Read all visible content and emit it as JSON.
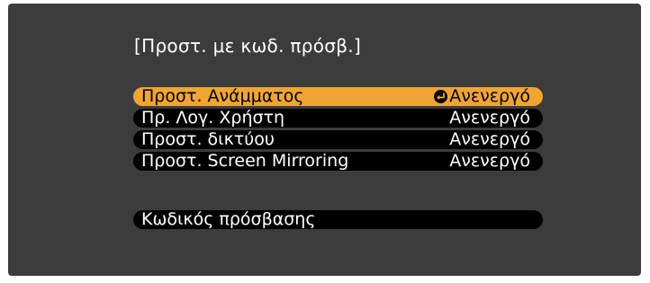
{
  "title": "[Προστ. με κωδ. πρόσβ.]",
  "menu": {
    "items": [
      {
        "label": "Προστ. Ανάμματος",
        "value": "Ανενεργό",
        "selected": true
      },
      {
        "label": "Πρ. Λογ. Χρήστη",
        "value": "Ανενεργό"
      },
      {
        "label": "Προστ. δικτύου",
        "value": "Ανενεργό"
      },
      {
        "label": "Προστ. Screen Mirroring",
        "value": "Ανενεργό"
      }
    ],
    "password_label": "Κωδικός πρόσβασης"
  },
  "colors": {
    "background": "#3c3c3c",
    "item_background": "#000000",
    "selected_background": "#f0a531",
    "text": "#ffffff"
  },
  "icons": {
    "selected_item": "enter-icon"
  }
}
